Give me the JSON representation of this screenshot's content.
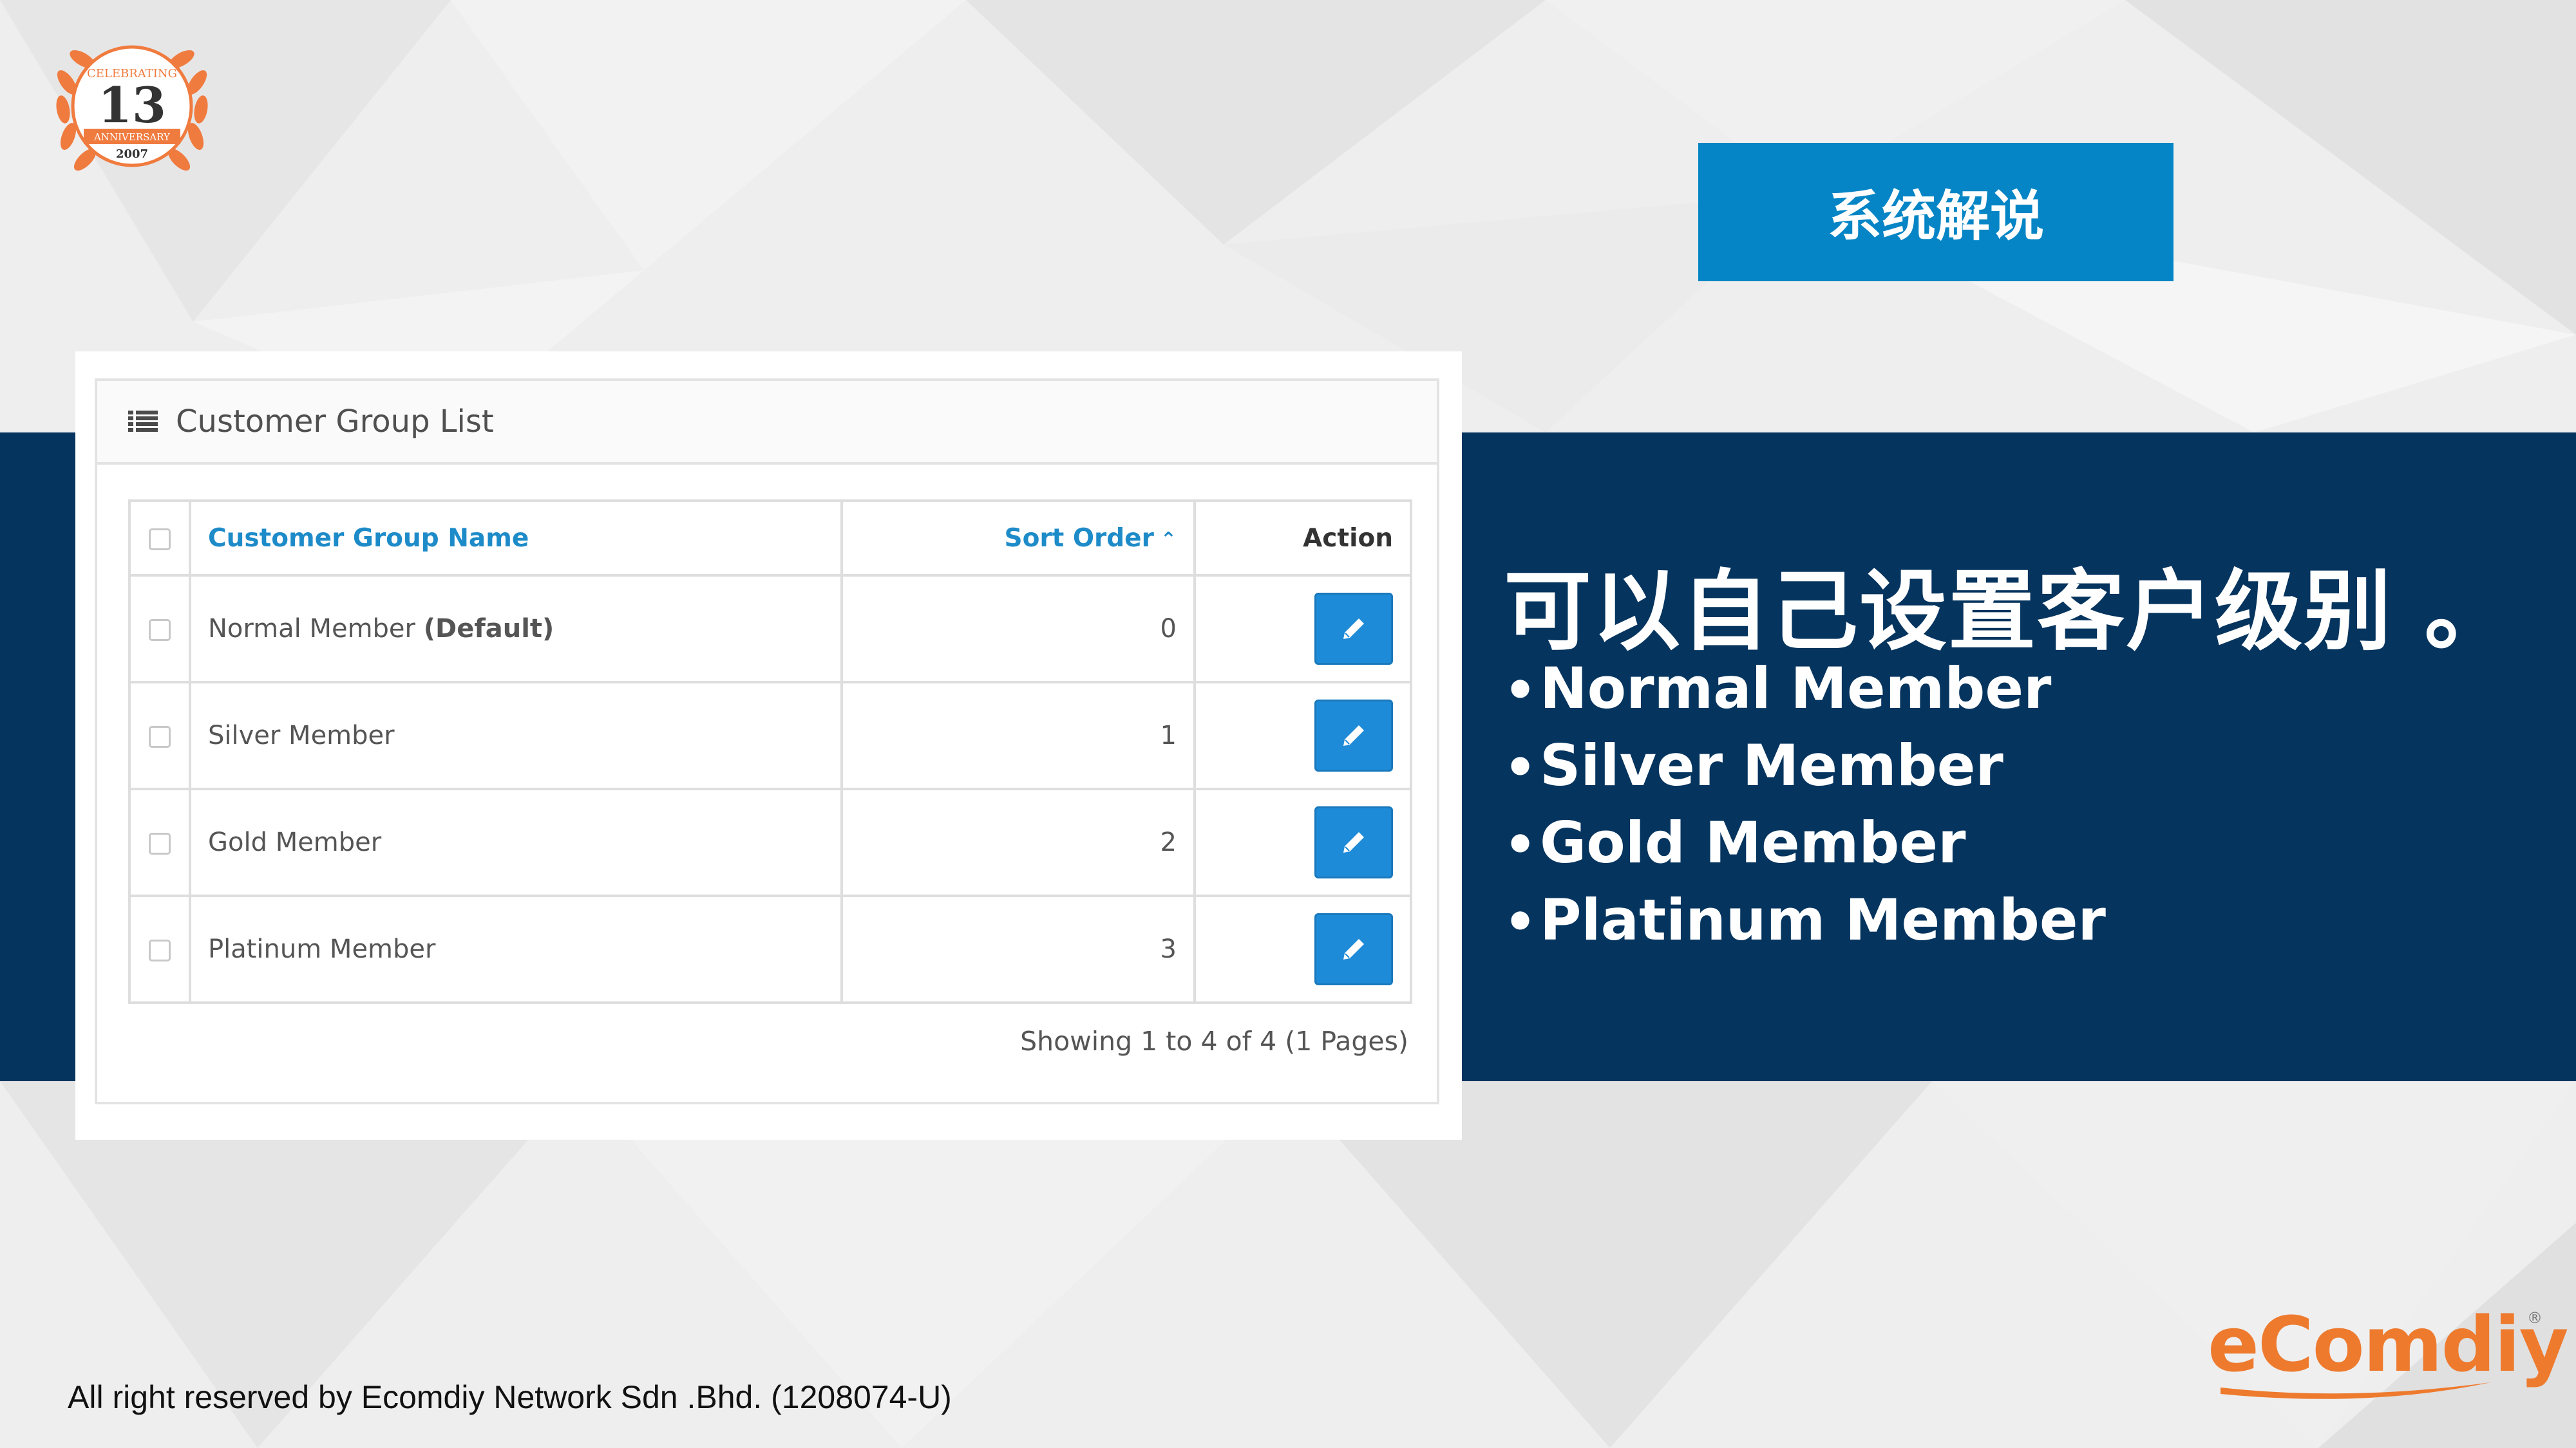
{
  "colors": {
    "band": "#05345e",
    "label_bg": "#0585c5",
    "link": "#1e8bc9",
    "button": "#1e8bd8",
    "brand_orange": "#ee7a2e",
    "badge_orange": "#f07b3f"
  },
  "badge": {
    "top_text": "CELEBRATING",
    "number": "13",
    "ribbon": "ANNIVERSARY",
    "year": "2007"
  },
  "section_label": "系统解说",
  "right": {
    "heading": "可以自己设置客户级别 。",
    "bullets": [
      "Normal Member",
      "Silver Member",
      "Gold Member",
      "Platinum Member"
    ]
  },
  "panel": {
    "title": "Customer Group List",
    "title_icon": "list-icon",
    "columns": {
      "name": "Customer Group Name",
      "sort_order": "Sort Order",
      "sort_icon": "caret-up-icon",
      "action": "Action"
    },
    "rows": [
      {
        "name": "Normal Member",
        "tag": "(Default)",
        "sort_order": "0",
        "action_icon": "pencil-icon"
      },
      {
        "name": "Silver Member",
        "tag": "",
        "sort_order": "1",
        "action_icon": "pencil-icon"
      },
      {
        "name": "Gold Member",
        "tag": "",
        "sort_order": "2",
        "action_icon": "pencil-icon"
      },
      {
        "name": "Platinum Member",
        "tag": "",
        "sort_order": "3",
        "action_icon": "pencil-icon"
      }
    ],
    "pagination": "Showing 1 to 4 of 4 (1 Pages)"
  },
  "footer": {
    "copyright": "All right reserved by Ecomdiy Network Sdn .Bhd. (1208074-U)",
    "brand": "eComdiy",
    "brand_mark": "®"
  }
}
